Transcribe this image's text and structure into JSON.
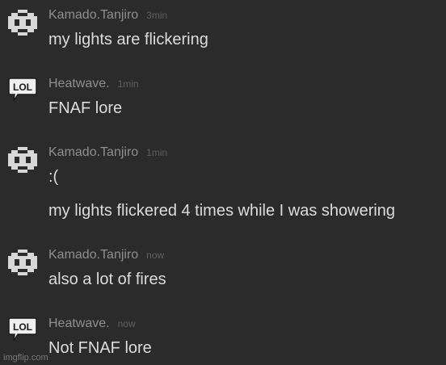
{
  "messages": [
    {
      "avatar_icon": "checker-pattern-icon",
      "author": "Kamado.Tanjiro",
      "time": "3min",
      "lines": [
        "my lights are flickering"
      ]
    },
    {
      "avatar_icon": "lol-speech-bubble-icon",
      "author": "Heatwave.",
      "time": "1min",
      "lines": [
        "FNAF lore"
      ]
    },
    {
      "avatar_icon": "checker-pattern-icon",
      "author": "Kamado.Tanjiro",
      "time": "1min",
      "lines": [
        ":(",
        "my lights flickered 4 times while I was showering"
      ]
    },
    {
      "avatar_icon": "checker-pattern-icon",
      "author": "Kamado.Tanjiro",
      "time": "now",
      "lines": [
        "also a lot of fires"
      ]
    },
    {
      "avatar_icon": "lol-speech-bubble-icon",
      "author": "Heatwave.",
      "time": "now",
      "lines": [
        "Not FNAF lore"
      ]
    }
  ],
  "watermark": "imgflip.com",
  "colors": {
    "background": "#2b2b2b",
    "author": "#8f8f8f",
    "timestamp": "#5f5f5f",
    "message_text": "#dcdcdc"
  }
}
